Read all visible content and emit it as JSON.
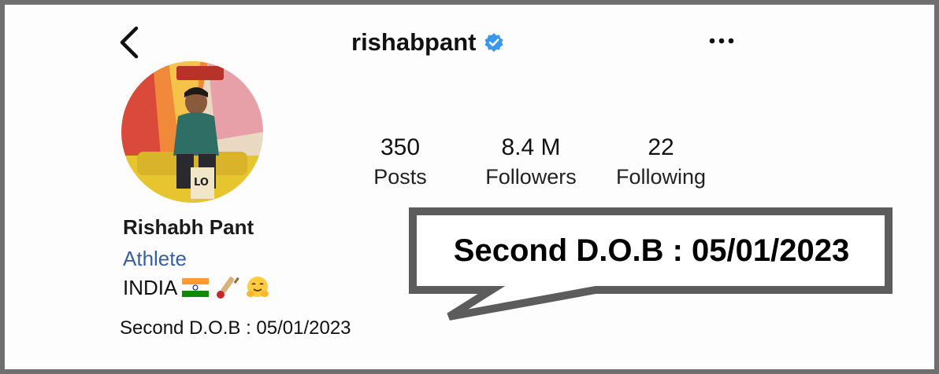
{
  "header": {
    "username": "rishabpant"
  },
  "stats": [
    {
      "count": "350",
      "label": "Posts"
    },
    {
      "count": "8.4 M",
      "label": "Followers"
    },
    {
      "count": "22",
      "label": "Following"
    }
  ],
  "profile": {
    "name": "Rishabh Pant",
    "category": "Athlete",
    "bio_text": "INDIA",
    "bio_emojis": [
      "flag-india-icon",
      "cricket-icon",
      "hug-emoji-icon"
    ],
    "dob_line": "Second D.O.B : 05/01/2023"
  },
  "callout": {
    "text": "Second D.O.B : 05/01/2023"
  },
  "colors": {
    "verified": "#3897f0",
    "category": "#3a5fa0",
    "frame": "#6f6f6f"
  }
}
